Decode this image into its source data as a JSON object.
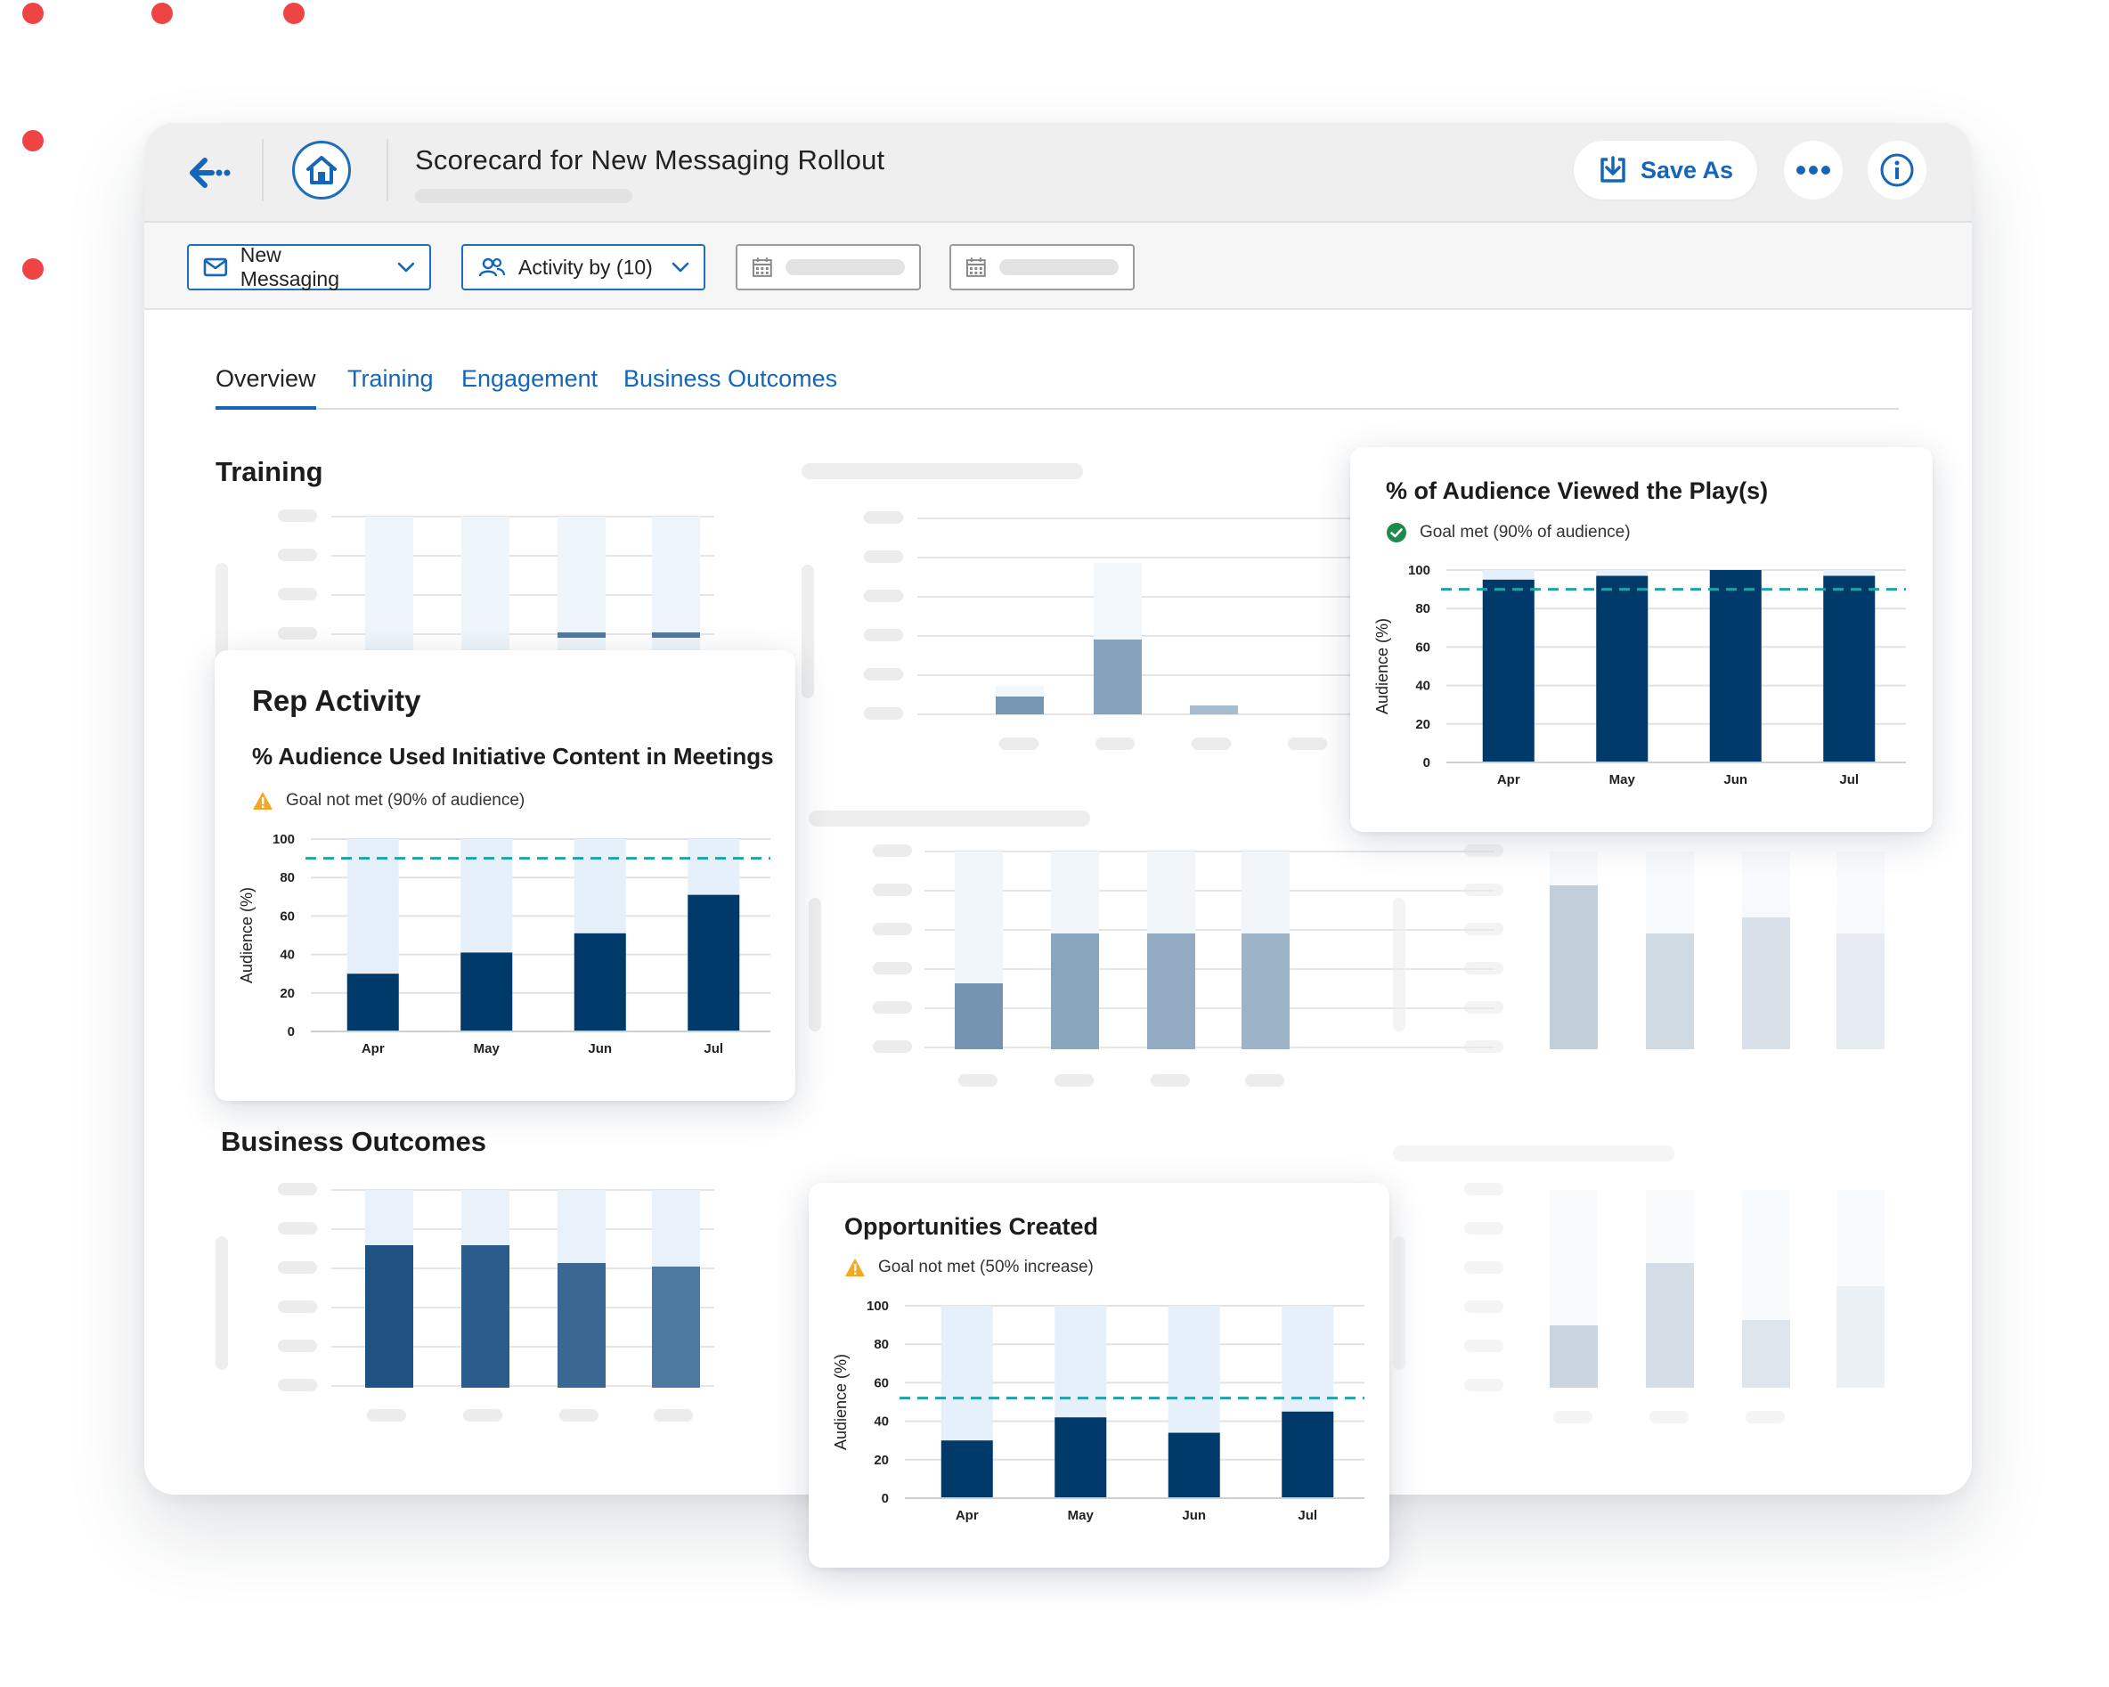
{
  "header": {
    "title": "Scorecard for New Messaging Rollout",
    "save_as_label": "Save As"
  },
  "filters": {
    "messaging": "New Messaging",
    "activity": "Activity by (10)"
  },
  "tabs": [
    {
      "label": "Overview"
    },
    {
      "label": "Training"
    },
    {
      "label": "Engagement"
    },
    {
      "label": "Business Outcomes"
    }
  ],
  "sections": {
    "training": "Training",
    "business_outcomes": "Business Outcomes"
  },
  "colors": {
    "primary": "#1565b8",
    "bar_dark": "#003a6b",
    "bar_track": "#e5f0fa",
    "goal_line": "#1fa3a8",
    "warning": "#f5a623",
    "success": "#1b8a4b",
    "dot": "#ef4444"
  },
  "cards": {
    "rep_activity": {
      "title": "Rep Activity",
      "subtitle": "% Audience Used Initiative Content in Meetings",
      "goal_text": "Goal not met (90% of audience)",
      "goal_status": "warning"
    },
    "audience_viewed": {
      "title": "% of Audience Viewed the Play(s)",
      "goal_text": "Goal met (90% of audience)",
      "goal_status": "success"
    },
    "opportunities": {
      "title": "Opportunities Created",
      "goal_text": "Goal not met (50% increase)",
      "goal_status": "warning"
    }
  },
  "chart_data": [
    {
      "id": "rep_activity",
      "type": "bar",
      "categories": [
        "Apr",
        "May",
        "Jun",
        "Jul"
      ],
      "values": [
        30,
        41,
        51,
        71
      ],
      "goal": 90,
      "ylabel": "Audience (%)",
      "ylim": [
        0,
        100
      ],
      "yticks": [
        0,
        20,
        40,
        60,
        80,
        100
      ],
      "grid": true
    },
    {
      "id": "audience_viewed",
      "type": "bar",
      "categories": [
        "Apr",
        "May",
        "Jun",
        "Jul"
      ],
      "values": [
        95,
        97,
        100,
        97
      ],
      "goal": 90,
      "ylabel": "Audience (%)",
      "ylim": [
        0,
        100
      ],
      "yticks": [
        0,
        20,
        40,
        60,
        80,
        100
      ],
      "grid": true
    },
    {
      "id": "opportunities",
      "type": "bar",
      "categories": [
        "Apr",
        "May",
        "Jun",
        "Jul"
      ],
      "values": [
        30,
        42,
        34,
        45
      ],
      "goal": 52,
      "ylabel": "Audience (%)",
      "ylim": [
        0,
        100
      ],
      "yticks": [
        0,
        20,
        40,
        60,
        80,
        100
      ],
      "grid": true
    }
  ]
}
